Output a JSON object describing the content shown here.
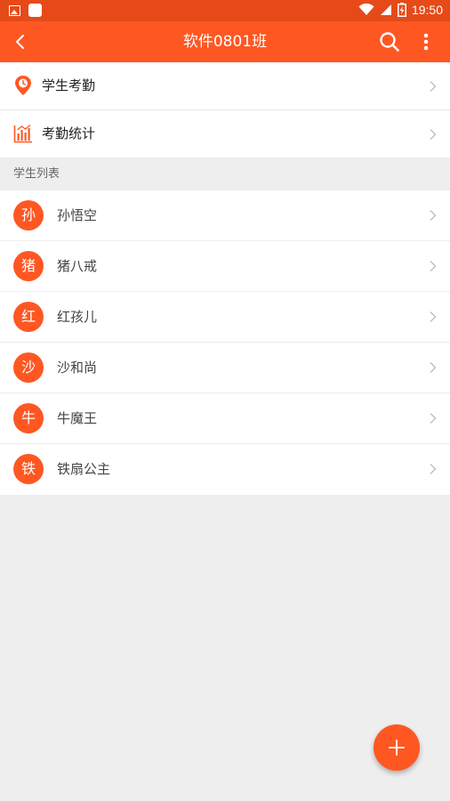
{
  "status_bar": {
    "time": "19:50",
    "icons": [
      "image-notification-icon",
      "app-notification-icon",
      "wifi-icon",
      "signal-icon",
      "battery-charging-icon"
    ]
  },
  "app_bar": {
    "title": "软件0801班",
    "back_icon": "back-arrow-icon",
    "search_icon": "search-icon",
    "more_icon": "more-vertical-icon"
  },
  "menu": {
    "items": [
      {
        "label": "学生考勤",
        "icon": "location-clock-icon"
      },
      {
        "label": "考勤统计",
        "icon": "bar-chart-icon"
      }
    ]
  },
  "student_section": {
    "header": "学生列表"
  },
  "students": [
    {
      "avatar": "孙",
      "name": "孙悟空"
    },
    {
      "avatar": "猪",
      "name": "猪八戒"
    },
    {
      "avatar": "红",
      "name": "红孩儿"
    },
    {
      "avatar": "沙",
      "name": "沙和尚"
    },
    {
      "avatar": "牛",
      "name": "牛魔王"
    },
    {
      "avatar": "铁",
      "name": "铁扇公主"
    }
  ],
  "fab": {
    "icon": "plus-icon"
  },
  "colors": {
    "primary": "#ff5722",
    "status_bar": "#e64a19",
    "background": "#eeeeee"
  }
}
